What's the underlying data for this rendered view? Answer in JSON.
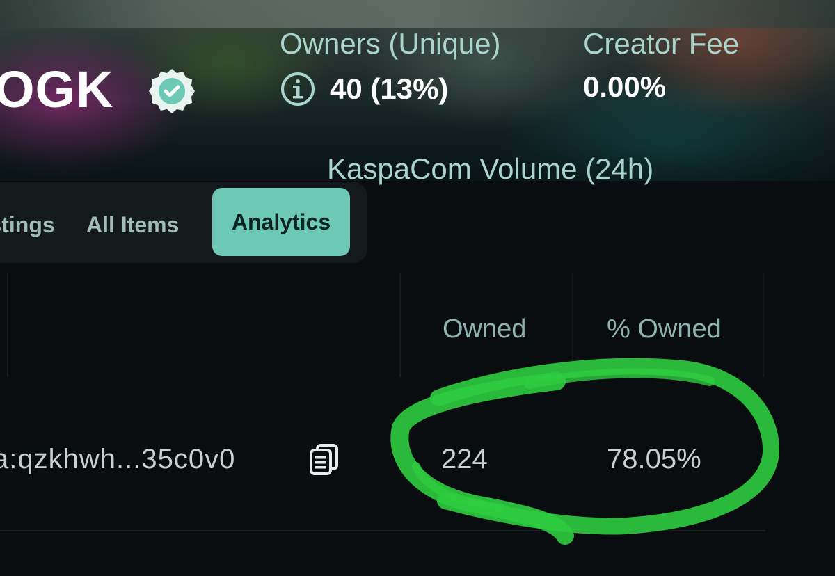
{
  "collection": {
    "name": "OGK",
    "verified_icon": "verified-badge-icon"
  },
  "stats": {
    "owners_label": "Owners (Unique)",
    "owners_value": "40 (13%)",
    "owners_info_icon": "info-icon",
    "creator_fee_label": "Creator Fee",
    "creator_fee_value": "0.00%",
    "volume_label": "KaspaCom Volume (24h)"
  },
  "tabs": [
    {
      "label": "Listings",
      "active": false
    },
    {
      "label": "All Items",
      "active": false
    },
    {
      "label": "Analytics",
      "active": true
    }
  ],
  "table": {
    "headers": {
      "owned": "Owned",
      "percent_owned": "% Owned"
    },
    "rows": [
      {
        "address": "a:qzkhwh...35c0v0",
        "copy_icon": "copy-icon",
        "owned": "224",
        "percent_owned": "78.05%"
      }
    ]
  },
  "colors": {
    "accent": "#6dc9b6",
    "background": "#0a0d0f",
    "annotation_marker": "#2ecc40"
  }
}
